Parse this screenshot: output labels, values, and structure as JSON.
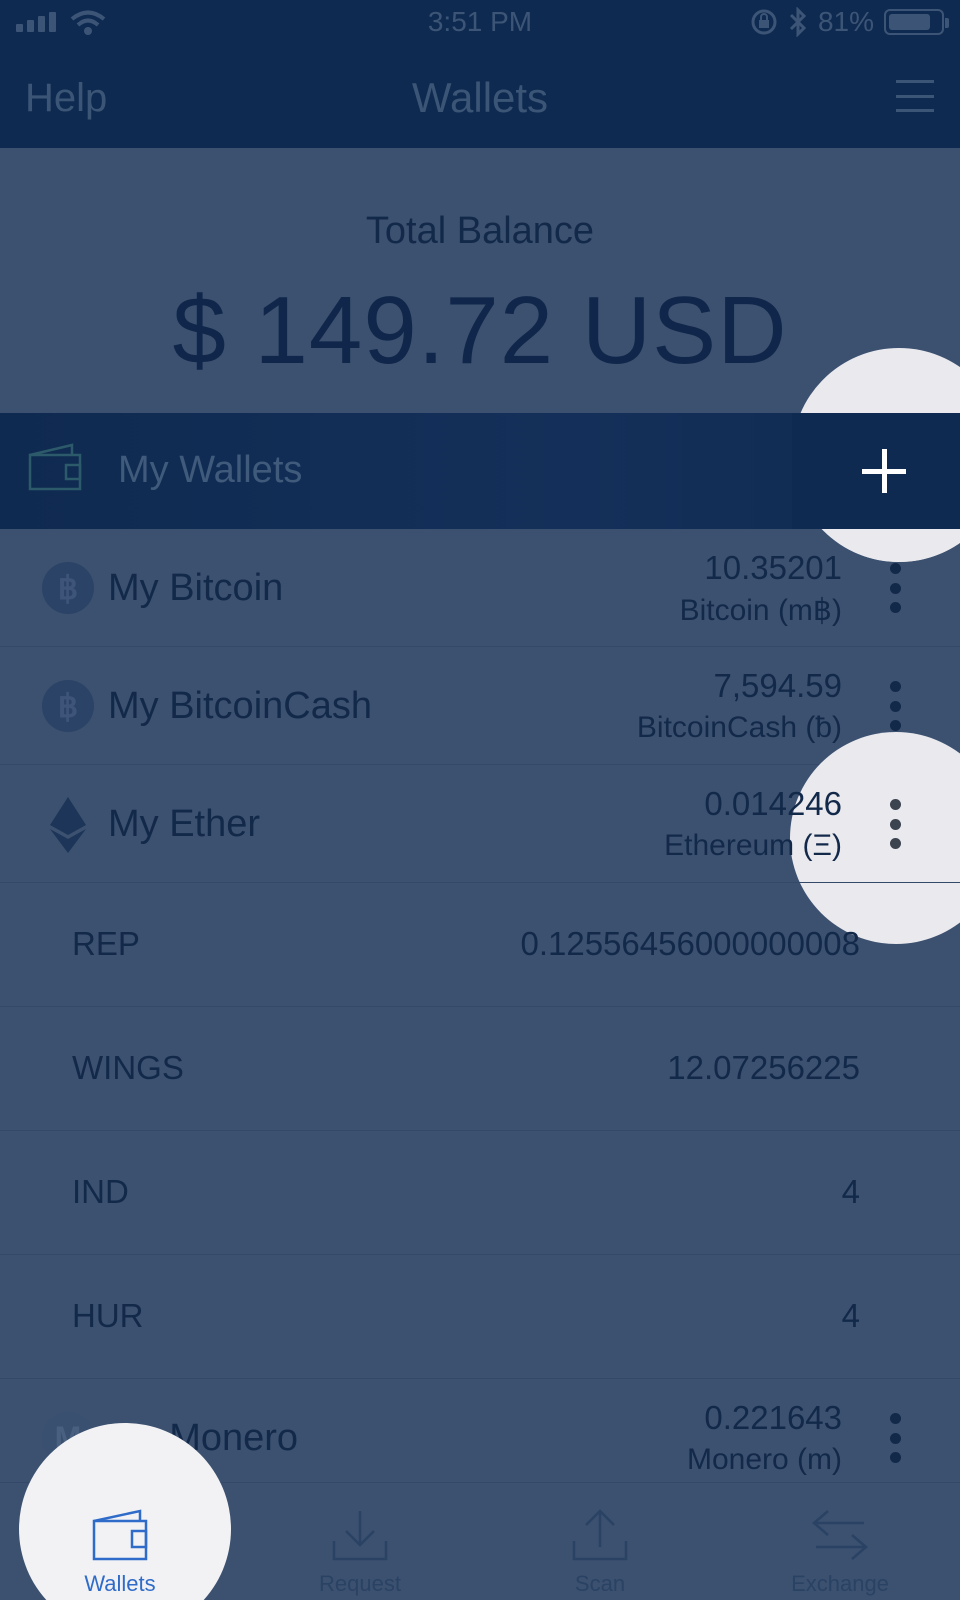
{
  "status_bar": {
    "time": "3:51 PM",
    "battery": "81%",
    "battery_level": 0.81,
    "icons": [
      "signal-icon",
      "wifi-icon",
      "rotation-lock-icon",
      "bluetooth-icon",
      "battery-icon"
    ]
  },
  "nav": {
    "left": "Help",
    "title": "Wallets",
    "right_icon": "hamburger-menu-icon"
  },
  "balance": {
    "label": "Total Balance",
    "amount": "$ 149.72 USD"
  },
  "wallets_header": {
    "label": "My Wallets",
    "add_icon": "plus-icon"
  },
  "wallets": [
    {
      "name": "My Bitcoin",
      "amount": "10.35201",
      "unit": "Bitcoin (m฿)",
      "icon": "bitcoin-icon",
      "icon_glyph": "฿"
    },
    {
      "name": "My BitcoinCash",
      "amount": "7,594.59",
      "unit": "BitcoinCash (ƀ)",
      "icon": "bitcoincash-icon",
      "icon_glyph": "฿"
    },
    {
      "name": "My Ether",
      "amount": "0.014246",
      "unit": "Ethereum (Ξ)",
      "icon": "ethereum-icon"
    },
    {
      "name": "My Monero",
      "amount": "0.221643",
      "unit": "Monero (m)",
      "icon": "monero-icon"
    }
  ],
  "tokens": [
    {
      "name": "REP",
      "value": "0.12556456000000008"
    },
    {
      "name": "WINGS",
      "value": "12.07256225"
    },
    {
      "name": "IND",
      "value": "4"
    },
    {
      "name": "HUR",
      "value": "4"
    }
  ],
  "tabs": [
    {
      "label": "Wallets",
      "icon": "wallet-icon",
      "active": true
    },
    {
      "label": "Request",
      "icon": "download-icon",
      "active": false
    },
    {
      "label": "Scan",
      "icon": "upload-icon",
      "active": false
    },
    {
      "label": "Exchange",
      "icon": "exchange-arrows-icon",
      "active": false
    }
  ],
  "colors": {
    "overlay": "#3c5170",
    "header_dark": "#0f2a50",
    "spotlight": "#e9e9ee",
    "active_tab": "#2f6cc9"
  }
}
